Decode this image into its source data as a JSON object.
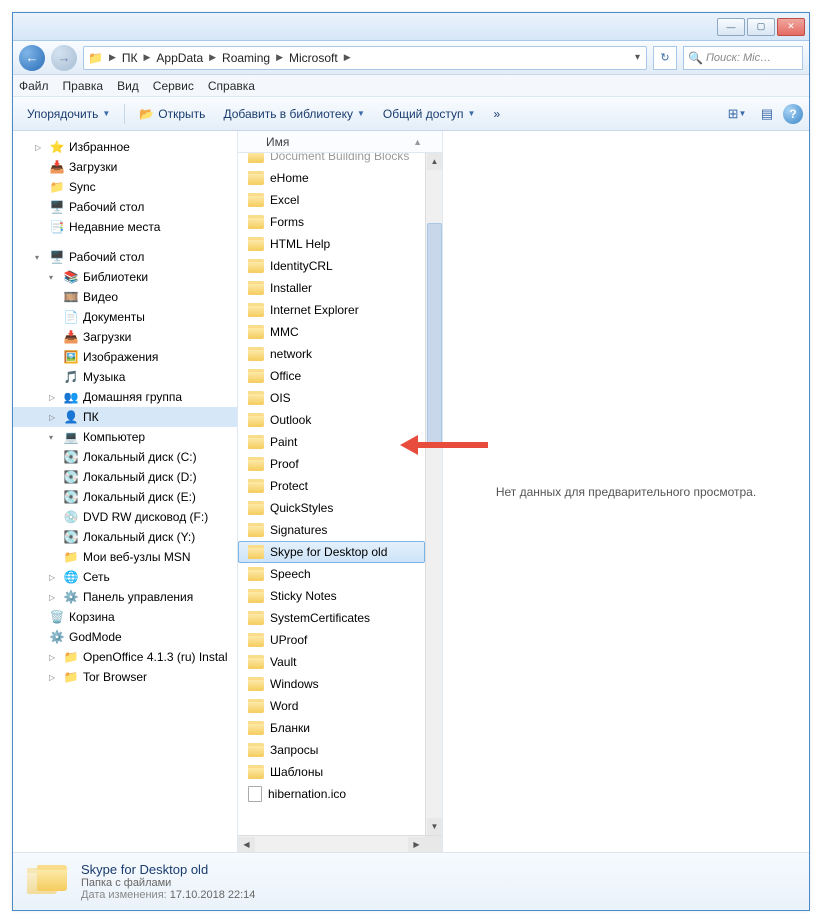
{
  "breadcrumb": {
    "items": [
      "ПК",
      "AppData",
      "Roaming",
      "Microsoft"
    ]
  },
  "search": {
    "placeholder": "Поиск: Mic…"
  },
  "menu": {
    "file": "Файл",
    "edit": "Правка",
    "view": "Вид",
    "service": "Сервис",
    "help": "Справка"
  },
  "cmd": {
    "organize": "Упорядочить",
    "open": "Открыть",
    "addlib": "Добавить в библиотеку",
    "share": "Общий доступ",
    "more": "»"
  },
  "listHeader": "Имя",
  "sidebar": {
    "favs": "Избранное",
    "downloads": "Загрузки",
    "sync": "Sync",
    "desktop": "Рабочий стол",
    "recent": "Недавние места",
    "desktop2": "Рабочий стол",
    "libraries": "Библиотеки",
    "video": "Видео",
    "documents": "Документы",
    "downloads2": "Загрузки",
    "images": "Изображения",
    "music": "Музыка",
    "homegroup": "Домашняя группа",
    "pc": "ПК",
    "computer": "Компьютер",
    "diskC": "Локальный диск (C:)",
    "diskD": "Локальный диск (D:)",
    "diskE": "Локальный диск (E:)",
    "dvd": "DVD RW дисковод (F:)",
    "diskY": "Локальный диск (Y:)",
    "msn": "Мои веб-узлы MSN",
    "network": "Сеть",
    "control": "Панель управления",
    "recycle": "Корзина",
    "godmode": "GodMode",
    "openoffice": "OpenOffice 4.1.3 (ru) Instal",
    "tor": "Tor Browser"
  },
  "files": [
    {
      "n": "Document Building Blocks",
      "t": "folder",
      "cut": true
    },
    {
      "n": "eHome",
      "t": "folder"
    },
    {
      "n": "Excel",
      "t": "folder"
    },
    {
      "n": "Forms",
      "t": "folder"
    },
    {
      "n": "HTML Help",
      "t": "folder"
    },
    {
      "n": "IdentityCRL",
      "t": "folder"
    },
    {
      "n": "Installer",
      "t": "folder"
    },
    {
      "n": "Internet Explorer",
      "t": "folder"
    },
    {
      "n": "MMC",
      "t": "folder"
    },
    {
      "n": "network",
      "t": "folder"
    },
    {
      "n": "Office",
      "t": "folder"
    },
    {
      "n": "OIS",
      "t": "folder"
    },
    {
      "n": "Outlook",
      "t": "folder"
    },
    {
      "n": "Paint",
      "t": "folder"
    },
    {
      "n": "Proof",
      "t": "folder"
    },
    {
      "n": "Protect",
      "t": "folder"
    },
    {
      "n": "QuickStyles",
      "t": "folder"
    },
    {
      "n": "Signatures",
      "t": "folder"
    },
    {
      "n": "Skype for Desktop old",
      "t": "folder",
      "selected": true
    },
    {
      "n": "Speech",
      "t": "folder"
    },
    {
      "n": "Sticky Notes",
      "t": "folder"
    },
    {
      "n": "SystemCertificates",
      "t": "folder"
    },
    {
      "n": "UProof",
      "t": "folder"
    },
    {
      "n": "Vault",
      "t": "folder"
    },
    {
      "n": "Windows",
      "t": "folder"
    },
    {
      "n": "Word",
      "t": "folder"
    },
    {
      "n": "Бланки",
      "t": "folder"
    },
    {
      "n": "Запросы",
      "t": "folder"
    },
    {
      "n": "Шаблоны",
      "t": "folder"
    },
    {
      "n": "hibernation.ico",
      "t": "file"
    }
  ],
  "preview": "Нет данных для предварительного просмотра.",
  "details": {
    "name": "Skype for Desktop old",
    "type": "Папка с файлами",
    "dateLabel": "Дата изменения:",
    "dateVal": "17.10.2018 22:14"
  }
}
